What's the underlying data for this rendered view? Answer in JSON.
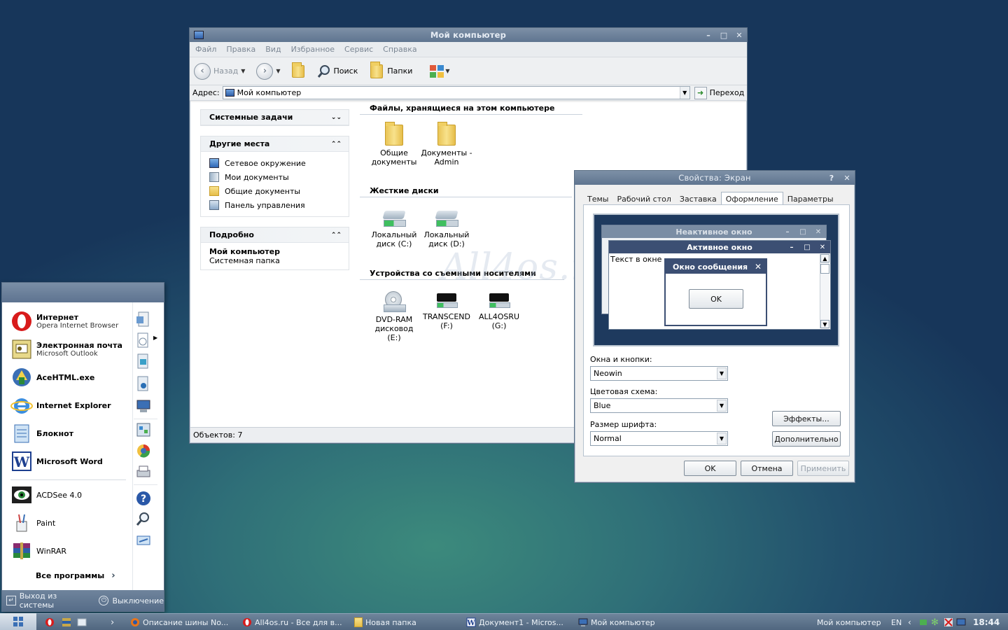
{
  "my_computer": {
    "title": "Мой компьютер",
    "menu": [
      "Файл",
      "Правка",
      "Вид",
      "Избранное",
      "Сервис",
      "Справка"
    ],
    "toolbar": {
      "back": "Назад",
      "search": "Поиск",
      "folders": "Папки"
    },
    "address": {
      "label": "Адрес:",
      "value": "Мой компьютер",
      "go": "Переход"
    },
    "panels": {
      "system_tasks": {
        "title": "Системные задачи"
      },
      "other_places": {
        "title": "Другие места",
        "links": [
          "Сетевое окружение",
          "Мои документы",
          "Общие документы",
          "Панель управления"
        ]
      },
      "details": {
        "title": "Подробно",
        "name": "Мой компьютер",
        "desc": "Системная папка"
      }
    },
    "sections": {
      "files": {
        "title": "Файлы, хранящиеся на этом компьютере",
        "items": [
          [
            "Общие",
            "документы"
          ],
          [
            "Документы -",
            "Admin"
          ]
        ]
      },
      "hdd": {
        "title": "Жесткие диски",
        "items": [
          [
            "Локальный",
            "диск (C:)"
          ],
          [
            "Локальный",
            "диск (D:)"
          ]
        ]
      },
      "removable": {
        "title": "Устройства со съемными носителями",
        "items": [
          [
            "DVD-RAM",
            "дисковод (E:)"
          ],
          [
            "TRANSCEND",
            "(F:)"
          ],
          [
            "ALL4OSRU",
            "(G:)"
          ]
        ]
      }
    },
    "status": "Объектов: 7"
  },
  "display_props": {
    "title": "Свойства: Экран",
    "tabs": [
      "Темы",
      "Рабочий стол",
      "Заставка",
      "Оформление",
      "Параметры"
    ],
    "active_tab": "Оформление",
    "preview": {
      "inactive": "Неактивное окно",
      "active": "Активное окно",
      "text": "Текст в окне",
      "msgbox": "Окно сообщения",
      "ok": "OK"
    },
    "windows_buttons": {
      "label": "Окна и кнопки:",
      "value": "Neowin"
    },
    "color_scheme": {
      "label": "Цветовая схема:",
      "value": "Blue"
    },
    "font_size": {
      "label": "Размер шрифта:",
      "value": "Normal"
    },
    "effects": "Эффекты...",
    "advanced": "Дополнительно",
    "ok": "OK",
    "cancel": "Отмена",
    "apply": "Применить"
  },
  "watermark": "All4os.ru",
  "start_menu": {
    "pinned": [
      {
        "name": "Интернет",
        "sub": "Opera Internet Browser",
        "icon": "opera-icon"
      },
      {
        "name": "Электронная почта",
        "sub": "Microsoft Outlook",
        "icon": "outlook-icon"
      }
    ],
    "recent": [
      "AceHTML.exe",
      "Internet Explorer",
      "Блокнот",
      "Microsoft Word",
      "ACDSee 4.0",
      "Paint",
      "WinRAR"
    ],
    "all_programs": "Все программы",
    "logoff": "Выход из системы",
    "shutdown": "Выключение"
  },
  "taskbar": {
    "tasks": [
      "Описание шины No...",
      "All4os.ru - Все для в...",
      "Новая папка",
      "Документ1 - Micros...",
      "Мой компьютер"
    ],
    "address_label": "Мой компьютер",
    "lang": "EN",
    "clock": "18:44"
  },
  "colors": {
    "title_bar": "#6b7f97",
    "desktop": "#2f6f78",
    "preview_active": "#3c4f73"
  }
}
